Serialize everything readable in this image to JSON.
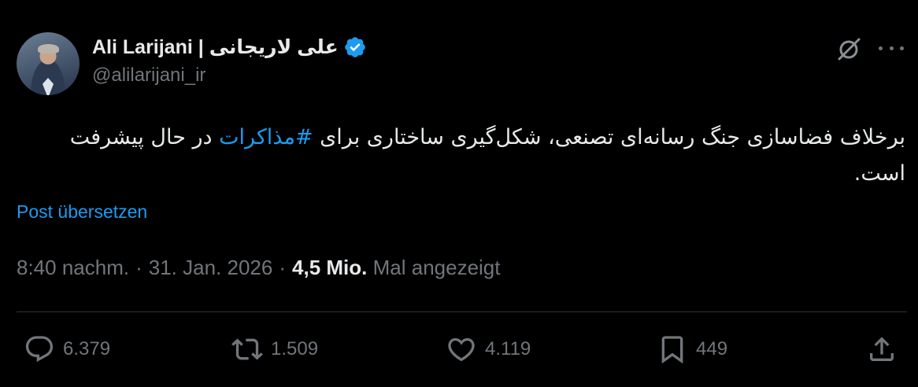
{
  "author": {
    "display_name": "Ali Larijani | علی لاریجانی",
    "handle": "@alilarijani_ir",
    "verified": true,
    "verified_color": "#1d9bf0"
  },
  "tweet": {
    "text_before_hashtag": "برخلاف فضاسازی جنگ رسانه‌ای تصنعی، شکل‌گیری ساختاری برای ",
    "hashtag": "#مذاکرات",
    "text_after_hashtag": " در حال پیشرفت است.",
    "translate_label": "Post übersetzen"
  },
  "meta": {
    "time": "8:40 nachm.",
    "separator": "·",
    "date": "31. Jan. 2026",
    "views_count": "4,5 Mio.",
    "views_label": "Mal angezeigt"
  },
  "actions": {
    "replies": "6.379",
    "reposts": "1.509",
    "likes": "4.119",
    "bookmarks": "449"
  },
  "icons": [
    "grok-icon",
    "more-icon",
    "verified-badge-icon",
    "reply-icon",
    "repost-icon",
    "like-icon",
    "bookmark-icon",
    "share-icon"
  ],
  "colors": {
    "background": "#000000",
    "text": "#e7e9ea",
    "muted": "#71767b",
    "accent": "#1d9bf0",
    "divider": "#2f3336"
  }
}
